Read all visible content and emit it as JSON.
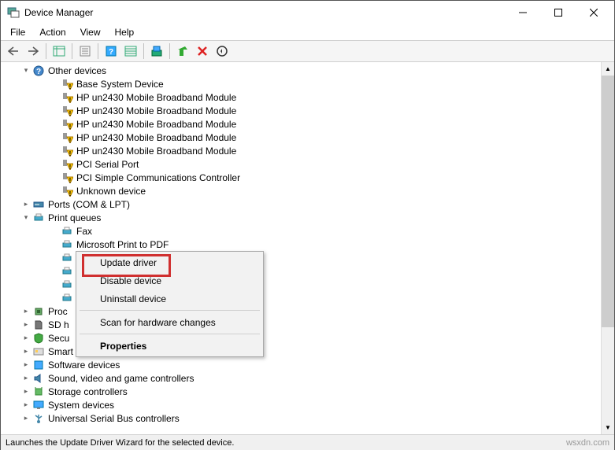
{
  "window": {
    "title": "Device Manager"
  },
  "menus": {
    "file": "File",
    "action": "Action",
    "view": "View",
    "help": "Help"
  },
  "tree": {
    "cat_other": "Other devices",
    "other_items": [
      "Base System Device",
      "HP un2430 Mobile Broadband Module",
      "HP un2430 Mobile Broadband Module",
      "HP un2430 Mobile Broadband Module",
      "HP un2430 Mobile Broadband Module",
      "HP un2430 Mobile Broadband Module",
      "PCI Serial Port",
      "PCI Simple Communications Controller",
      "Unknown device"
    ],
    "cat_ports": "Ports (COM & LPT)",
    "cat_print": "Print queues",
    "print_items": [
      "Fax",
      "Microsoft Print to PDF",
      "",
      "",
      "",
      ""
    ],
    "cat_proc": "Proc",
    "cat_sdh": "SD h",
    "cat_secu": "Secu",
    "cat_smart": "Smart card readers",
    "cat_soft": "Software devices",
    "cat_sound": "Sound, video and game controllers",
    "cat_storage": "Storage controllers",
    "cat_sysdev": "System devices",
    "cat_usb": "Universal Serial Bus controllers"
  },
  "context": {
    "update": "Update driver",
    "disable": "Disable device",
    "uninstall": "Uninstall device",
    "scan": "Scan for hardware changes",
    "properties": "Properties"
  },
  "status": "Launches the Update Driver Wizard for the selected device.",
  "watermark": "wsxdn.com"
}
